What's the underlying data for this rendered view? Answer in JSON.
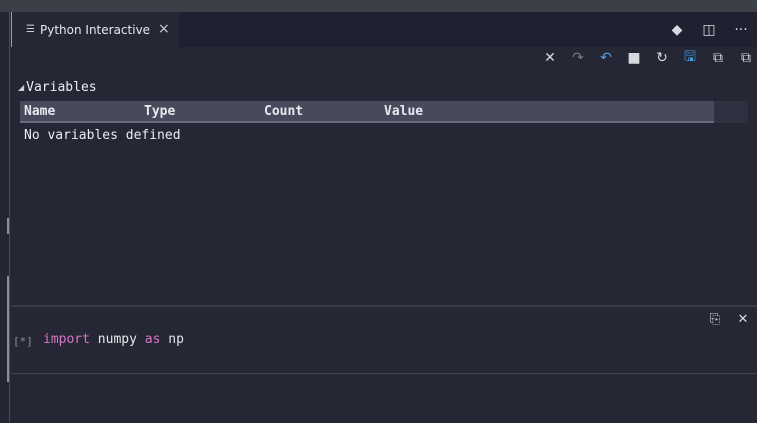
{
  "tab": {
    "title": "Python Interactive",
    "icon": "lines-icon",
    "close": "×"
  },
  "tab_actions": [
    {
      "name": "git-compare-icon",
      "glyph": "◆"
    },
    {
      "name": "split-editor-icon",
      "glyph": "◫"
    },
    {
      "name": "more-actions-icon",
      "glyph": "···"
    }
  ],
  "toolbar": [
    {
      "name": "clear-all-icon",
      "glyph": "✕",
      "state": "normal"
    },
    {
      "name": "redo-icon",
      "glyph": "↷",
      "state": "disabled"
    },
    {
      "name": "undo-icon",
      "glyph": "↶",
      "state": "active"
    },
    {
      "name": "interrupt-icon",
      "glyph": "■",
      "state": "normal"
    },
    {
      "name": "restart-icon",
      "glyph": "↻",
      "state": "normal"
    },
    {
      "name": "save-icon",
      "glyph": "🖫",
      "state": "active"
    },
    {
      "name": "expand-all-icon",
      "glyph": "⧉",
      "state": "normal"
    },
    {
      "name": "collapse-all-icon",
      "glyph": "⧉",
      "state": "normal"
    }
  ],
  "variables": {
    "title": "Variables",
    "columns": [
      "Name",
      "Type",
      "Count",
      "Value"
    ],
    "empty_message": "No variables defined"
  },
  "cell": {
    "exec_count": "[*]",
    "code_tokens": [
      {
        "text": "import",
        "kind": "keyword"
      },
      {
        "text": " numpy ",
        "kind": "plain"
      },
      {
        "text": "as",
        "kind": "keyword"
      },
      {
        "text": " np",
        "kind": "plain"
      }
    ],
    "actions": [
      {
        "name": "copy-code-icon",
        "glyph": "⎘"
      },
      {
        "name": "delete-cell-icon",
        "glyph": "✕"
      }
    ]
  },
  "colors": {
    "background": "#262734",
    "keyword": "#d477c4",
    "active_icon": "#4aa3f0",
    "grid_header": "#48495b"
  }
}
